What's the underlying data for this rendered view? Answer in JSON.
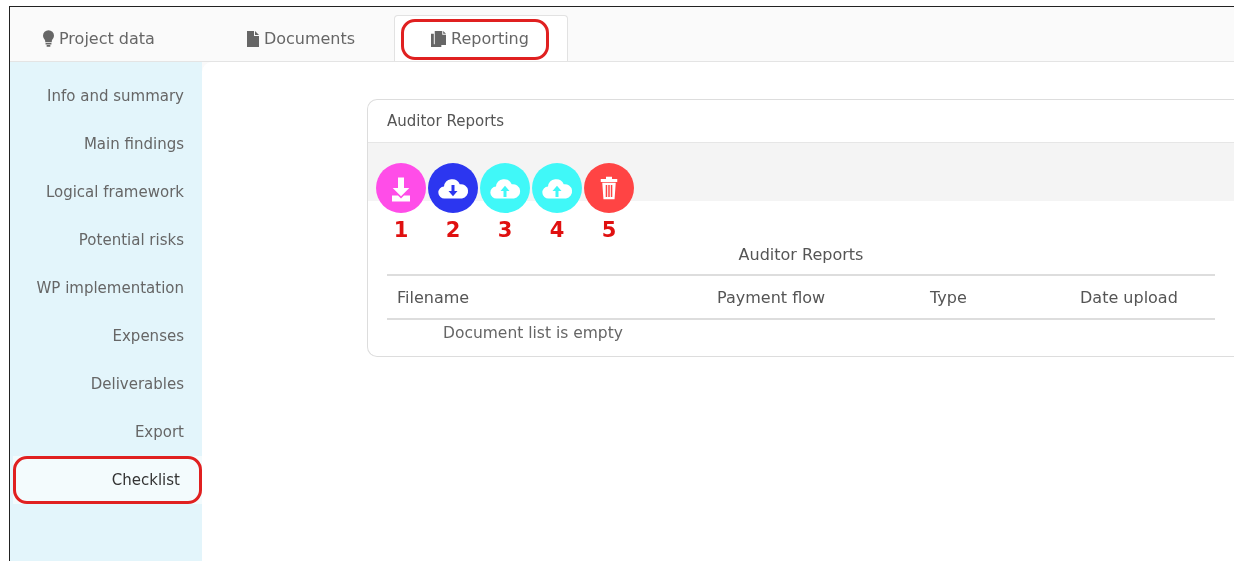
{
  "tabs": [
    {
      "label": "Project data",
      "kind": "bulb",
      "selected": false,
      "highlighted": false
    },
    {
      "label": "Documents",
      "kind": "file",
      "selected": false,
      "highlighted": false
    },
    {
      "label": "Reporting",
      "kind": "files",
      "selected": true,
      "highlighted": true
    }
  ],
  "sidebar": {
    "items": [
      {
        "label": "Info and summary",
        "selected": false,
        "highlighted": false
      },
      {
        "label": "Main findings",
        "selected": false,
        "highlighted": false
      },
      {
        "label": "Logical framework",
        "selected": false,
        "highlighted": false
      },
      {
        "label": "Potential risks",
        "selected": false,
        "highlighted": false
      },
      {
        "label": "WP implementation",
        "selected": false,
        "highlighted": false
      },
      {
        "label": "Expenses",
        "selected": false,
        "highlighted": false
      },
      {
        "label": "Deliverables",
        "selected": false,
        "highlighted": false
      },
      {
        "label": "Export",
        "selected": false,
        "highlighted": false
      },
      {
        "label": "Checklist",
        "selected": true,
        "highlighted": true
      }
    ]
  },
  "card": {
    "title": "Auditor Reports",
    "actions": [
      {
        "kind": "download",
        "color": "#ff4de8",
        "annotation": "1"
      },
      {
        "kind": "cloud-download",
        "color": "#2c36f0",
        "annotation": "2"
      },
      {
        "kind": "cloud-upload",
        "color": "#40f8f8",
        "annotation": "3"
      },
      {
        "kind": "cloud-upload",
        "color": "#40f8f8",
        "annotation": "4"
      },
      {
        "kind": "delete",
        "color": "#ff4444",
        "annotation": "5"
      }
    ],
    "table": {
      "caption": "Auditor Reports",
      "columns": [
        "Filename",
        "Payment flow",
        "Type",
        "Date upload"
      ],
      "empty_text": "Document list is empty"
    }
  }
}
